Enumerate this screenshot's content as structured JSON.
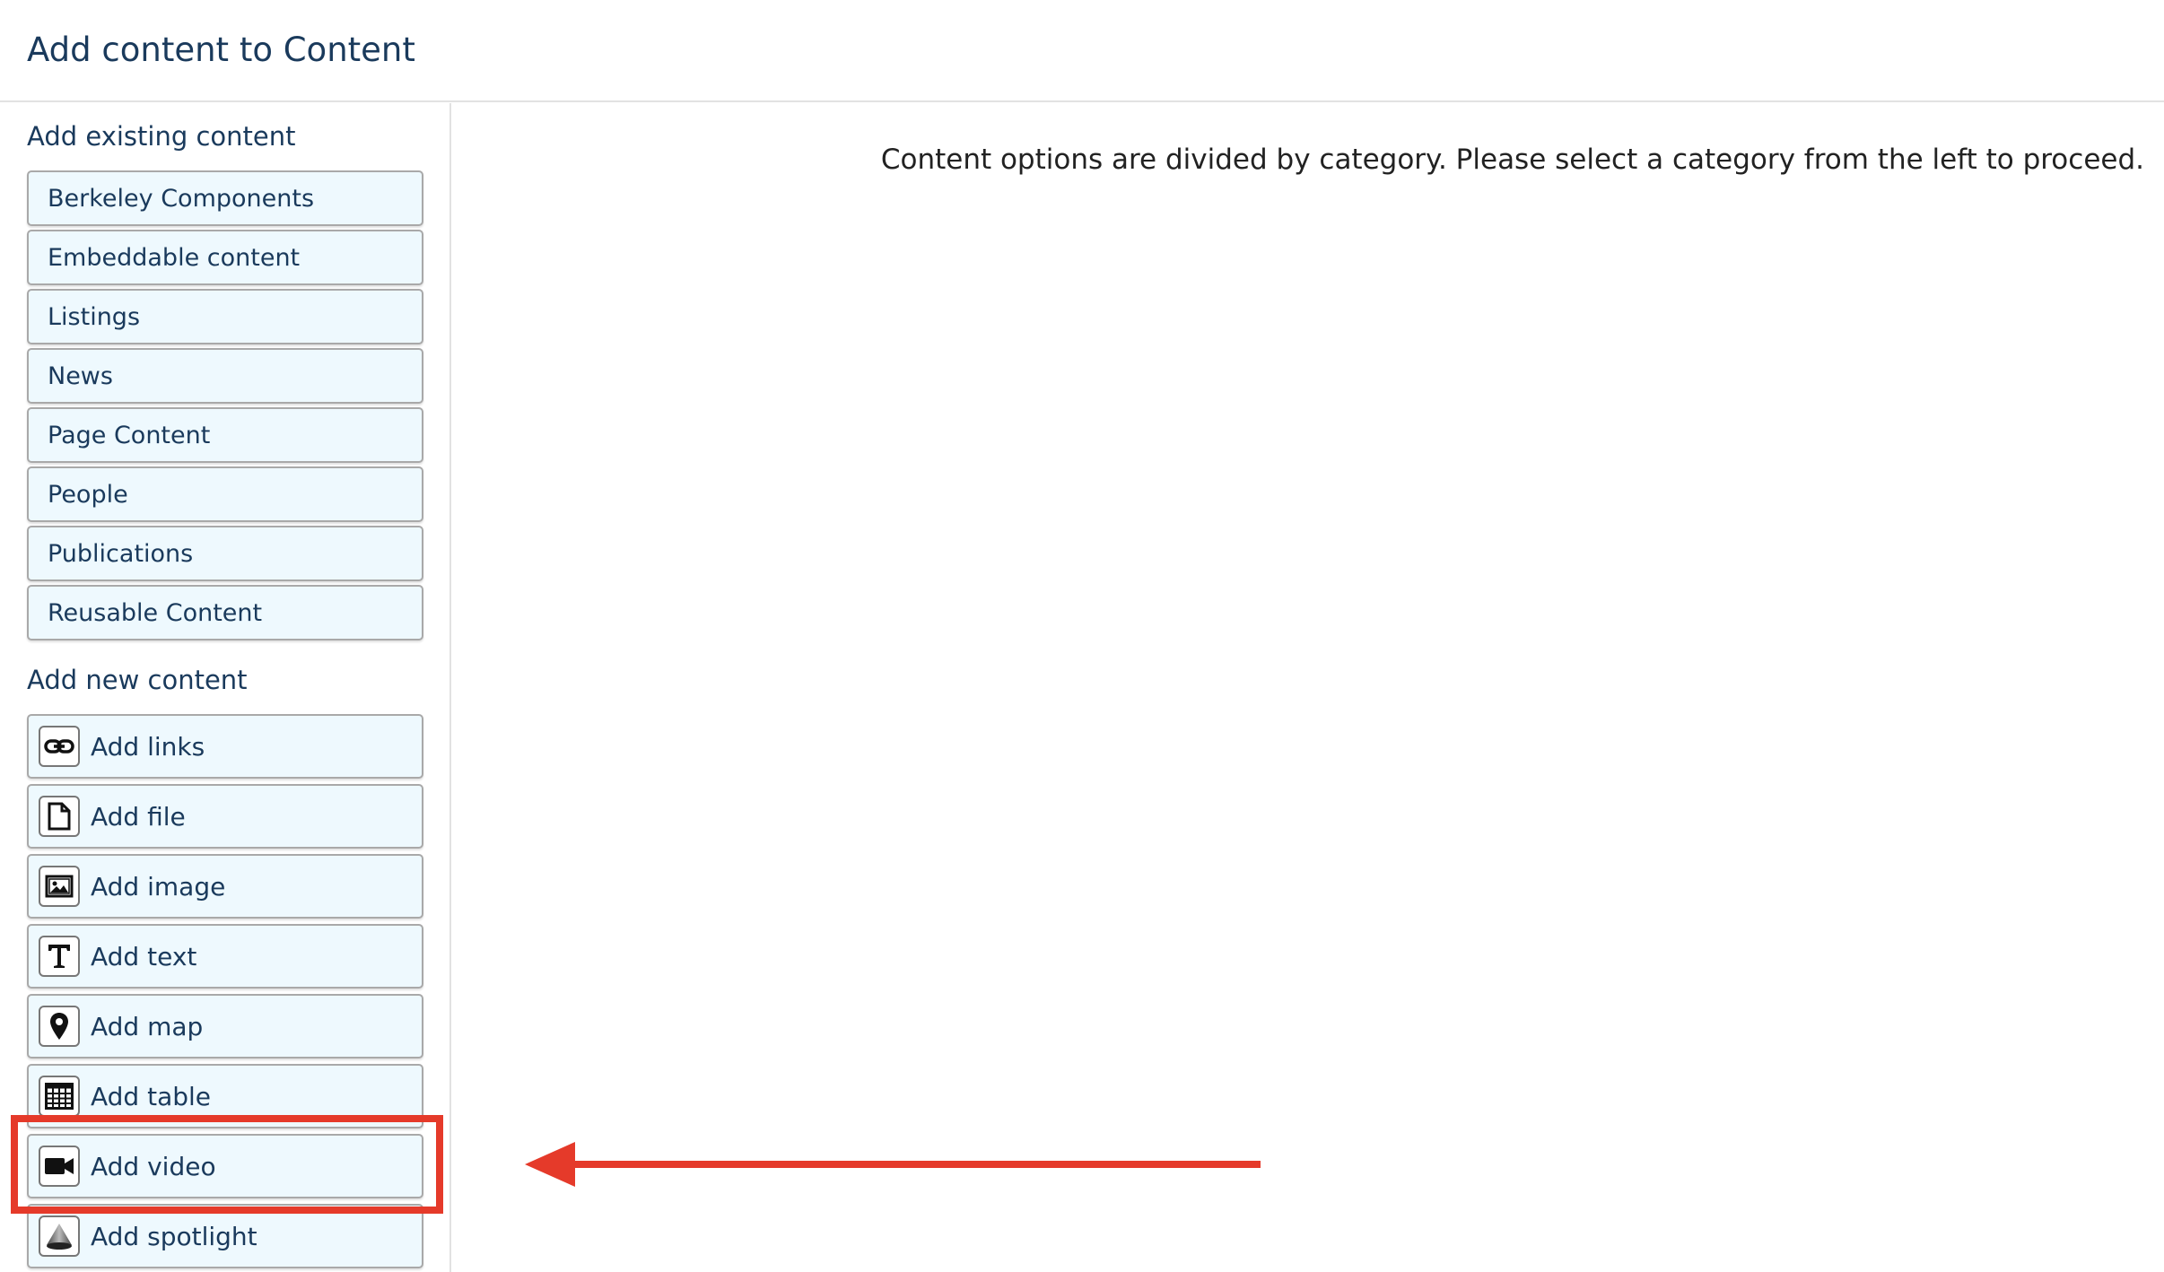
{
  "header": {
    "title": "Add content to Content"
  },
  "sidebar": {
    "existing_heading": "Add existing content",
    "existing_items": [
      {
        "label": "Berkeley Components"
      },
      {
        "label": "Embeddable content"
      },
      {
        "label": "Listings"
      },
      {
        "label": "News"
      },
      {
        "label": "Page Content"
      },
      {
        "label": "People"
      },
      {
        "label": "Publications"
      },
      {
        "label": "Reusable Content"
      }
    ],
    "new_heading": "Add new content",
    "new_items": [
      {
        "label": "Add links",
        "icon": "link-icon"
      },
      {
        "label": "Add file",
        "icon": "file-icon"
      },
      {
        "label": "Add image",
        "icon": "image-icon"
      },
      {
        "label": "Add text",
        "icon": "text-icon"
      },
      {
        "label": "Add map",
        "icon": "map-pin-icon"
      },
      {
        "label": "Add table",
        "icon": "table-icon"
      },
      {
        "label": "Add video",
        "icon": "video-camera-icon"
      },
      {
        "label": "Add spotlight",
        "icon": "spotlight-icon"
      }
    ]
  },
  "main": {
    "message": "Content options are divided by category. Please select a category from the left to proceed."
  },
  "annotation": {
    "highlight_color": "#e53a2a"
  }
}
